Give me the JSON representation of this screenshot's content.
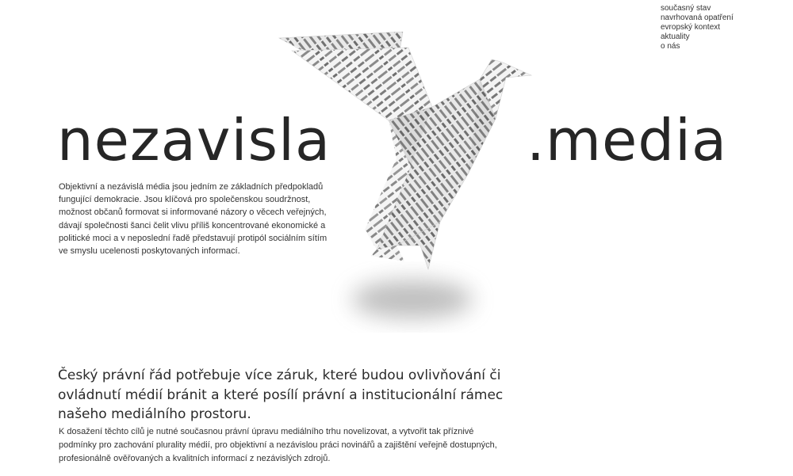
{
  "nav": {
    "items": [
      {
        "label": "současný stav"
      },
      {
        "label": "navrhovaná opatření"
      },
      {
        "label": "evropský kontext"
      },
      {
        "label": "aktuality"
      },
      {
        "label": "o nás"
      }
    ]
  },
  "logo": {
    "left": "nezavisla",
    "right": ".media"
  },
  "intro": {
    "text": "Objektivní a nezávislá média jsou jedním ze základních předpokladů fungující demokracie. Jsou klíčová pro společenskou soudržnost, možnost občanů formovat si informované názory o věcech veřejných, dávají společnosti šanci čelit vlivu příliš koncentrované ekonomické a politické moci a v neposlední řadě představují protipól sociálním sítím ve smyslu ucelenosti poskytovaných informací."
  },
  "bird_text": {
    "line1": "Objektivní a nezávislá média jsou jedním ze základních předpokladů fungující demokracie.",
    "line2": "Jsou klíčová pro společenskou soudržnost, dávají společnosti šanci čelit vlivu příliš koncentrované politické moci."
  },
  "section": {
    "headline": "Český právní řád potřebuje více záruk, které budou ovlivňování či ovládnutí médií bránit a které posílí právní a institucionální rámec našeho mediálního prostoru.",
    "body": "K dosažení těchto cílů je nutné současnou právní úpravu mediálního trhu novelizovat, a vytvořit tak příznivé podmínky pro zachování plurality médií, pro objektivní a nezávislou práci novinářů a zajištění veřejně dostupných, profesionálně ověřovaných a kvalitních informací z nezávislých zdrojů."
  }
}
